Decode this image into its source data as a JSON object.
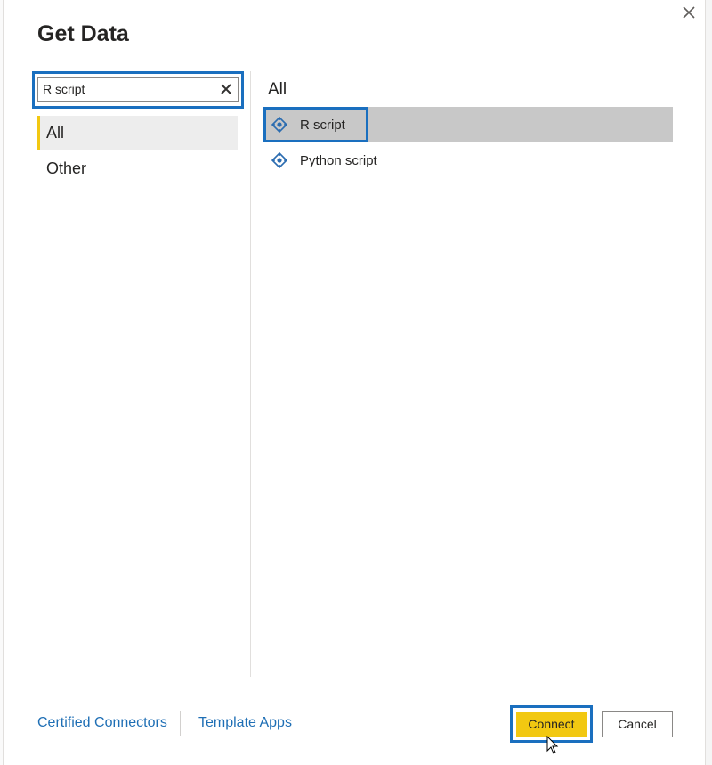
{
  "dialog": {
    "title": "Get Data",
    "close_icon": "close-icon"
  },
  "search": {
    "value": "R script",
    "clear_icon": "clear-icon"
  },
  "categories": [
    {
      "label": "All",
      "selected": true
    },
    {
      "label": "Other",
      "selected": false
    }
  ],
  "results": {
    "section_label": "All",
    "items": [
      {
        "label": "R script",
        "icon": "script-connector-icon",
        "selected": true
      },
      {
        "label": "Python script",
        "icon": "script-connector-icon",
        "selected": false
      }
    ]
  },
  "footer": {
    "links": [
      {
        "label": "Certified Connectors"
      },
      {
        "label": "Template Apps"
      }
    ],
    "connect_label": "Connect",
    "cancel_label": "Cancel"
  },
  "colors": {
    "accent_yellow": "#f2c811",
    "highlight_blue": "#1a6fbf",
    "link_blue": "#1f6fb5",
    "selected_row": "#c8c8c8"
  }
}
